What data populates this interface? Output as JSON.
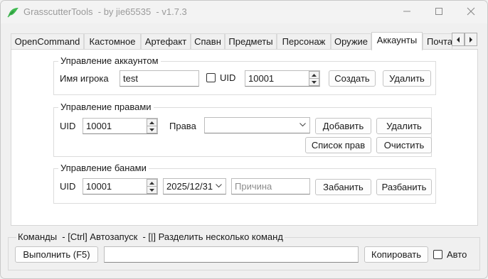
{
  "window": {
    "title": "GrasscutterTools  - by jie65535  - v1.7.3"
  },
  "tabs": [
    {
      "label": "OpenCommand"
    },
    {
      "label": "Кастомное"
    },
    {
      "label": "Артефакт"
    },
    {
      "label": "Спавн"
    },
    {
      "label": "Предметы"
    },
    {
      "label": "Персонаж"
    },
    {
      "label": "Оружие"
    },
    {
      "label": "Аккаунты",
      "active": true
    },
    {
      "label": "Почта"
    }
  ],
  "account": {
    "group_title": "Управление аккаунтом",
    "player_name_label": "Имя игрока",
    "player_name_value": "test",
    "uid_check_label": "UID",
    "uid_value": "10001",
    "create_label": "Создать",
    "delete_label": "Удалить"
  },
  "rights": {
    "group_title": "Управление правами",
    "uid_label": "UID",
    "uid_value": "10001",
    "perm_label": "Права",
    "perm_value": "",
    "add_label": "Добавить",
    "delete_label": "Удалить",
    "list_label": "Список прав",
    "clear_label": "Очистить"
  },
  "bans": {
    "group_title": "Управление банами",
    "uid_label": "UID",
    "uid_value": "10001",
    "date_value": "2025/12/31",
    "reason_placeholder": "Причина",
    "ban_label": "Забанить",
    "unban_label": "Разбанить"
  },
  "commands": {
    "title": "Команды  - [Ctrl] Автозапуск  - [|] Разделить несколько команд",
    "run_label": "Выполнить (F5)",
    "command_value": "",
    "copy_label": "Копировать",
    "auto_label": "Авто"
  },
  "colors": {
    "window_bg": "#f0f0f0",
    "panel_bg": "#ffffff",
    "logo_green": "#3fb950"
  },
  "icons": [
    "app-logo-icon",
    "minimize-icon",
    "maximize-icon",
    "close-icon",
    "tab-scroll-left-icon",
    "tab-scroll-right-icon",
    "chevron-down-icon",
    "spin-up-icon",
    "spin-down-icon"
  ]
}
